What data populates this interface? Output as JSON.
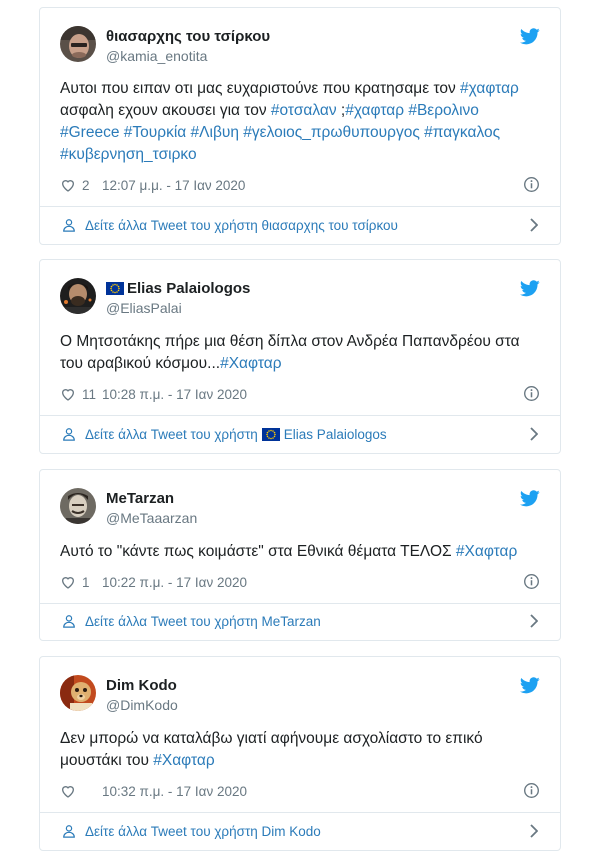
{
  "tweets": [
    {
      "display_name": "θιασαρχης του τσίρκου",
      "handle": "@kamia_enotita",
      "eu_flag": false,
      "text_segments": [
        {
          "t": "Αυτοι που ειπαν οτι μας ευχαριστούνε που κρατησαμε τον "
        },
        {
          "t": "#χαφταρ",
          "tag": true
        },
        {
          "t": " ασφαλη εχουν ακουσει για τον "
        },
        {
          "t": "#οτσαλαν",
          "tag": true
        },
        {
          "t": " ;"
        },
        {
          "t": "#χαφταρ",
          "tag": true
        },
        {
          "t": " "
        },
        {
          "t": "#Βερολινο",
          "tag": true
        },
        {
          "t": " "
        },
        {
          "t": "#Greece",
          "tag": true
        },
        {
          "t": " "
        },
        {
          "t": "#Τουρκία",
          "tag": true
        },
        {
          "t": " "
        },
        {
          "t": "#Λιβυη",
          "tag": true
        },
        {
          "t": " "
        },
        {
          "t": "#γελοιος_πρωθυπουργος",
          "tag": true
        },
        {
          "t": " "
        },
        {
          "t": "#παγκαλος",
          "tag": true
        },
        {
          "t": " "
        },
        {
          "t": "#κυβερνηση_τσιρκο",
          "tag": true
        }
      ],
      "likes": "2",
      "timestamp": "12:07 μ.μ. - 17 Ιαν 2020",
      "more_label": "Δείτε άλλα Tweet του χρήστη θιασαρχης του τσίρκου",
      "more_eu_flag": false
    },
    {
      "display_name": "Elias Palaiologos",
      "handle": "@EliasPalai",
      "eu_flag": true,
      "text_segments": [
        {
          "t": "Ο Μητσοτάκης πήρε μια θέση δίπλα στον Ανδρέα Παπανδρέου στα του αραβικού κόσμου..."
        },
        {
          "t": "#Χαφταρ",
          "tag": true
        }
      ],
      "likes": "11",
      "timestamp": "10:28 π.μ. - 17 Ιαν 2020",
      "more_label": "Δείτε άλλα Tweet του χρήστη",
      "more_name": "Elias Palaiologos",
      "more_eu_flag": true
    },
    {
      "display_name": "MeTarzan",
      "handle": "@MeTaaarzan",
      "eu_flag": false,
      "text_segments": [
        {
          "t": "Αυτό το \"κάντε πως κοιμάστε\" στα Εθνικά θέματα ΤΕΛΟΣ "
        },
        {
          "t": "#Χαφταρ",
          "tag": true
        }
      ],
      "likes": "1",
      "timestamp": "10:22 π.μ. - 17 Ιαν 2020",
      "more_label": "Δείτε άλλα Tweet του χρήστη MeTarzan",
      "more_eu_flag": false
    },
    {
      "display_name": "Dim Kodo",
      "handle": "@DimKodo",
      "eu_flag": false,
      "text_segments": [
        {
          "t": "Δεν μπορώ να καταλάβω γιατί αφήνουμε ασχολίαστο το επικό μουστάκι του "
        },
        {
          "t": "#Χαφταρ",
          "tag": true
        }
      ],
      "likes": "",
      "timestamp": "10:32 π.μ. - 17 Ιαν 2020",
      "more_label": "Δείτε άλλα Tweet του χρήστη Dim Kodo",
      "more_eu_flag": false
    }
  ],
  "colors": {
    "link": "#2b7bb9",
    "twitter_bird": "#1da1f2",
    "meta_text": "#697882",
    "border": "#e1e8ed",
    "eu_blue": "#003399",
    "eu_star": "#ffcc00"
  },
  "icons": {
    "brand": "twitter-bird-icon",
    "like": "heart-icon",
    "info": "info-icon",
    "user": "user-icon",
    "chevron": "chevron-right-icon",
    "flag": "eu-flag-icon"
  }
}
